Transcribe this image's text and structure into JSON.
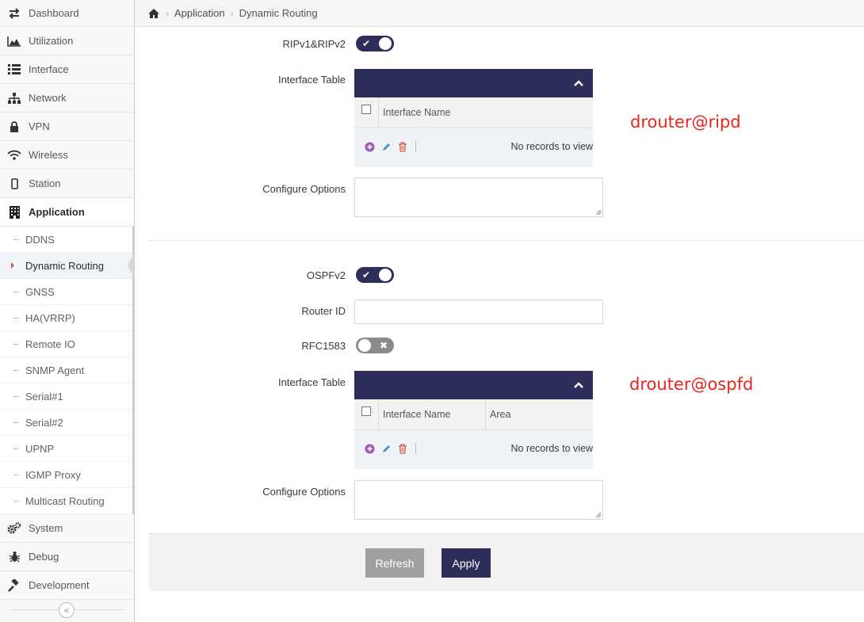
{
  "sidebar": {
    "items": [
      {
        "label": "Dashboard",
        "icon": "exchange-icon"
      },
      {
        "label": "Utilization",
        "icon": "area-chart-icon"
      },
      {
        "label": "Interface",
        "icon": "list-icon"
      },
      {
        "label": "Network",
        "icon": "sitemap-icon"
      },
      {
        "label": "VPN",
        "icon": "lock-icon"
      },
      {
        "label": "Wireless",
        "icon": "wifi-icon"
      },
      {
        "label": "Station",
        "icon": "mobile-icon"
      },
      {
        "label": "Application",
        "icon": "building-icon",
        "active": true
      }
    ],
    "sub_items": [
      {
        "label": "DDNS"
      },
      {
        "label": "Dynamic Routing",
        "active": true
      },
      {
        "label": "GNSS"
      },
      {
        "label": "HA(VRRP)"
      },
      {
        "label": "Remote IO"
      },
      {
        "label": "SNMP Agent"
      },
      {
        "label": "Serial#1"
      },
      {
        "label": "Serial#2"
      },
      {
        "label": "UPNP"
      },
      {
        "label": "IGMP Proxy"
      },
      {
        "label": "Multicast Routing"
      }
    ],
    "bottom_items": [
      {
        "label": "System",
        "icon": "cogs-icon"
      },
      {
        "label": "Debug",
        "icon": "bug-icon"
      },
      {
        "label": "Development",
        "icon": "gavel-icon"
      }
    ],
    "collapse_glyph": "«"
  },
  "breadcrumb": {
    "items": [
      "Application",
      "Dynamic Routing"
    ],
    "separator": "›"
  },
  "rip": {
    "toggle_label": "RIPv1&RIPv2",
    "toggle_state": "on",
    "toggle_glyph": "✔",
    "table_label": "Interface Table",
    "columns": [
      "Interface Name"
    ],
    "no_records": "No records to view",
    "options_label": "Configure Options",
    "options_value": "",
    "annotation": "drouter@ripd"
  },
  "ospf": {
    "toggle_label": "OSPFv2",
    "toggle_state": "on",
    "toggle_glyph": "✔",
    "router_id_label": "Router ID",
    "router_id_value": "",
    "rfc_label": "RFC1583",
    "rfc_state": "off",
    "rfc_glyph": "✖",
    "table_label": "Interface Table",
    "columns": [
      "Interface Name",
      "Area"
    ],
    "no_records": "No records to view",
    "options_label": "Configure Options",
    "options_value": "",
    "annotation": "drouter@ospfd"
  },
  "actions": {
    "refresh": "Refresh",
    "apply": "Apply"
  },
  "colors": {
    "primary": "#2e2e5c",
    "annotation": "#e8251f",
    "toggle_off": "#8b8b8b",
    "refresh_button": "#a0a0a0"
  }
}
